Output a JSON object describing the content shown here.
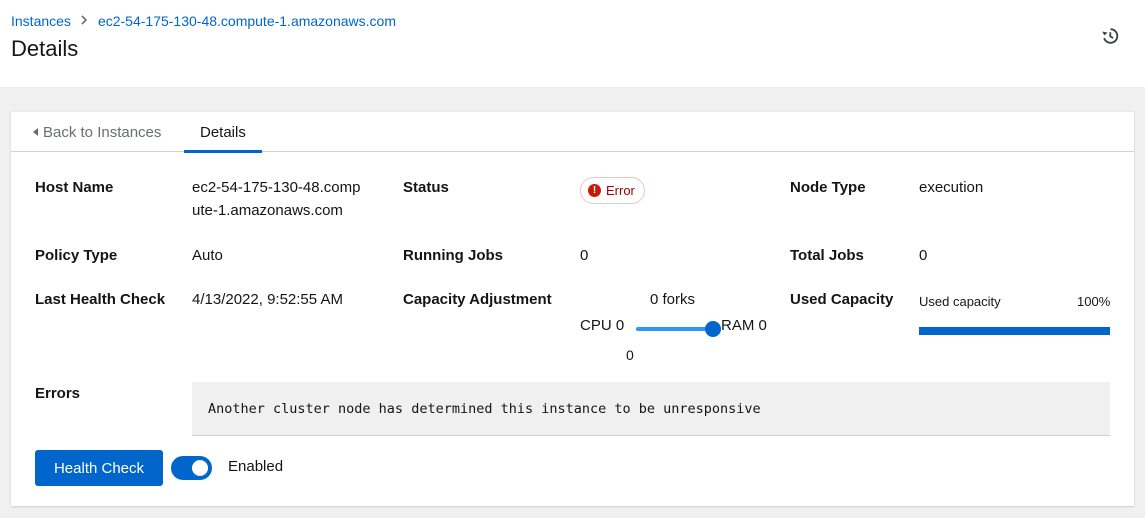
{
  "breadcrumb": {
    "root": "Instances",
    "current": "ec2-54-175-130-48.compute-1.amazonaws.com"
  },
  "page": {
    "title": "Details"
  },
  "icons": {
    "history": "history-icon",
    "error": "exclamation-circle-icon",
    "back": "caret-left-icon"
  },
  "colors": {
    "accent": "#0066cc",
    "error": "#c9190b",
    "slider": "#2b9af3"
  },
  "tabs": [
    {
      "label": "Back to Instances",
      "active": false
    },
    {
      "label": "Details",
      "active": true
    }
  ],
  "details": {
    "host_name_label": "Host Name",
    "host_name_line1": "ec2-54-175-130-48.comp",
    "host_name_line2": "ute-1.amazonaws.com",
    "status_label": "Status",
    "status_value": "Error",
    "node_type_label": "Node Type",
    "node_type_value": "execution",
    "policy_type_label": "Policy Type",
    "policy_type_value": "Auto",
    "running_jobs_label": "Running Jobs",
    "running_jobs_value": "0",
    "total_jobs_label": "Total Jobs",
    "total_jobs_value": "0",
    "last_health_check_label": "Last Health Check",
    "last_health_check_value": "4/13/2022, 9:52:55 AM",
    "capacity_adjustment_label": "Capacity Adjustment",
    "forks": "0 forks",
    "cpu": "CPU 0",
    "ram": "RAM 0",
    "slider_value": "0",
    "slider_position": 1.0,
    "used_capacity_label": "Used Capacity",
    "used_capacity_caption": "Used capacity",
    "used_capacity_percent": "100%",
    "used_capacity_fraction": 1.0,
    "errors_label": "Errors",
    "errors_value": "Another cluster node has determined this instance to be unresponsive"
  },
  "actions": {
    "health_check_label": "Health Check",
    "toggle_label": "Enabled",
    "toggle_on": true
  }
}
